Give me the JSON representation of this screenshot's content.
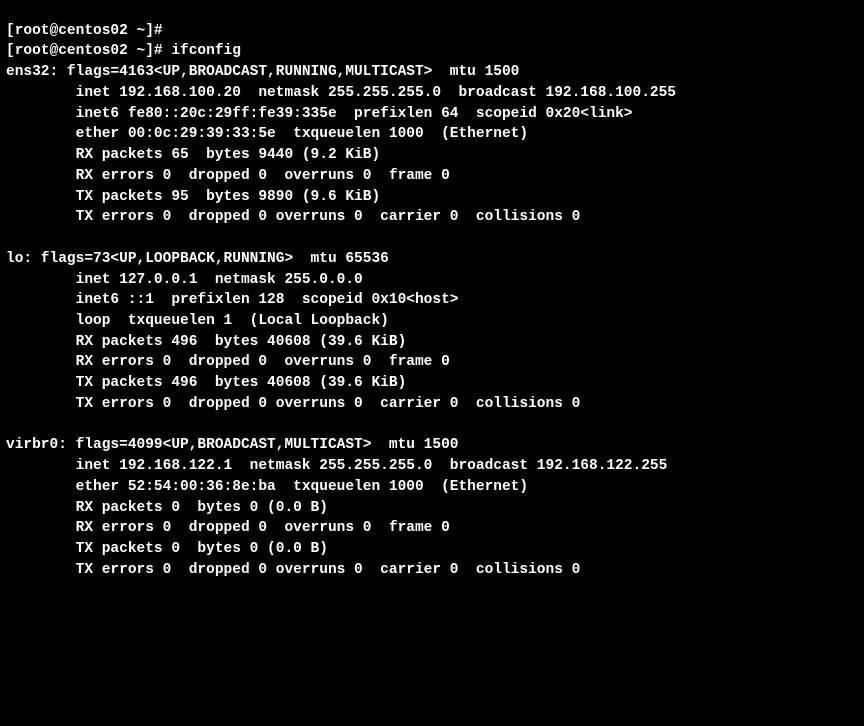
{
  "lines": [
    "[root@centos02 ~]#",
    "[root@centos02 ~]# ifconfig",
    "ens32: flags=4163<UP,BROADCAST,RUNNING,MULTICAST>  mtu 1500",
    "        inet 192.168.100.20  netmask 255.255.255.0  broadcast 192.168.100.255",
    "        inet6 fe80::20c:29ff:fe39:335e  prefixlen 64  scopeid 0x20<link>",
    "        ether 00:0c:29:39:33:5e  txqueuelen 1000  (Ethernet)",
    "        RX packets 65  bytes 9440 (9.2 KiB)",
    "        RX errors 0  dropped 0  overruns 0  frame 0",
    "        TX packets 95  bytes 9890 (9.6 KiB)",
    "        TX errors 0  dropped 0 overruns 0  carrier 0  collisions 0",
    "",
    "lo: flags=73<UP,LOOPBACK,RUNNING>  mtu 65536",
    "        inet 127.0.0.1  netmask 255.0.0.0",
    "        inet6 ::1  prefixlen 128  scopeid 0x10<host>",
    "        loop  txqueuelen 1  (Local Loopback)",
    "        RX packets 496  bytes 40608 (39.6 KiB)",
    "        RX errors 0  dropped 0  overruns 0  frame 0",
    "        TX packets 496  bytes 40608 (39.6 KiB)",
    "        TX errors 0  dropped 0 overruns 0  carrier 0  collisions 0",
    "",
    "virbr0: flags=4099<UP,BROADCAST,MULTICAST>  mtu 1500",
    "        inet 192.168.122.1  netmask 255.255.255.0  broadcast 192.168.122.255",
    "        ether 52:54:00:36:8e:ba  txqueuelen 1000  (Ethernet)",
    "        RX packets 0  bytes 0 (0.0 B)",
    "        RX errors 0  dropped 0  overruns 0  frame 0",
    "        TX packets 0  bytes 0 (0.0 B)",
    "        TX errors 0  dropped 0 overruns 0  carrier 0  collisions 0",
    ""
  ],
  "interfaces": {
    "ens32": {
      "flags": "4163<UP,BROADCAST,RUNNING,MULTICAST>",
      "mtu": 1500,
      "inet": "192.168.100.20",
      "netmask": "255.255.255.0",
      "broadcast": "192.168.100.255",
      "inet6": "fe80::20c:29ff:fe39:335e",
      "prefixlen": 64,
      "scopeid": "0x20<link>",
      "ether": "00:0c:29:39:33:5e",
      "txqueuelen": 1000,
      "type": "Ethernet",
      "rx_packets": 65,
      "rx_bytes": "9440 (9.2 KiB)",
      "rx_errors": 0,
      "rx_dropped": 0,
      "rx_overruns": 0,
      "rx_frame": 0,
      "tx_packets": 95,
      "tx_bytes": "9890 (9.6 KiB)",
      "tx_errors": 0,
      "tx_dropped": 0,
      "tx_overruns": 0,
      "tx_carrier": 0,
      "tx_collisions": 0
    },
    "lo": {
      "flags": "73<UP,LOOPBACK,RUNNING>",
      "mtu": 65536,
      "inet": "127.0.0.1",
      "netmask": "255.0.0.0",
      "inet6": "::1",
      "prefixlen": 128,
      "scopeid": "0x10<host>",
      "loop": true,
      "txqueuelen": 1,
      "type": "Local Loopback",
      "rx_packets": 496,
      "rx_bytes": "40608 (39.6 KiB)",
      "rx_errors": 0,
      "rx_dropped": 0,
      "rx_overruns": 0,
      "rx_frame": 0,
      "tx_packets": 496,
      "tx_bytes": "40608 (39.6 KiB)",
      "tx_errors": 0,
      "tx_dropped": 0,
      "tx_overruns": 0,
      "tx_carrier": 0,
      "tx_collisions": 0
    },
    "virbr0": {
      "flags": "4099<UP,BROADCAST,MULTICAST>",
      "mtu": 1500,
      "inet": "192.168.122.1",
      "netmask": "255.255.255.0",
      "broadcast": "192.168.122.255",
      "ether": "52:54:00:36:8e:ba",
      "txqueuelen": 1000,
      "type": "Ethernet",
      "rx_packets": 0,
      "rx_bytes": "0 (0.0 B)",
      "rx_errors": 0,
      "rx_dropped": 0,
      "rx_overruns": 0,
      "rx_frame": 0,
      "tx_packets": 0,
      "tx_bytes": "0 (0.0 B)",
      "tx_errors": 0,
      "tx_dropped": 0,
      "tx_overruns": 0,
      "tx_carrier": 0,
      "tx_collisions": 0
    }
  },
  "prompt": "[root@centos02 ~]#",
  "command": "ifconfig"
}
